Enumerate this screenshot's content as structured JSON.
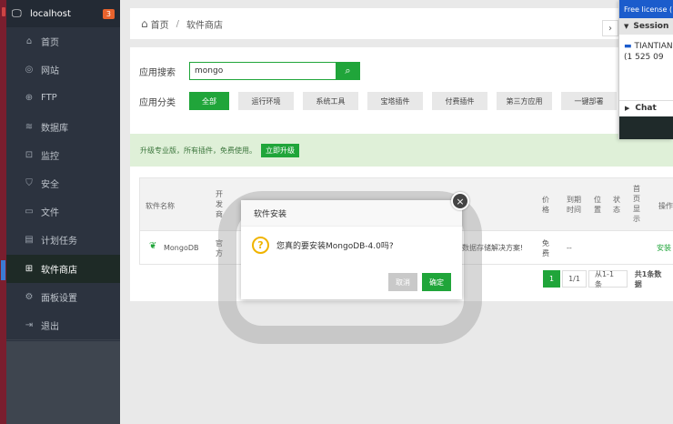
{
  "sidebar": {
    "host": "localhost",
    "badge": "3",
    "items": [
      {
        "label": "首页",
        "icon": "home-icon"
      },
      {
        "label": "网站",
        "icon": "globe-icon"
      },
      {
        "label": "FTP",
        "icon": "ftp-icon"
      },
      {
        "label": "数据库",
        "icon": "database-icon"
      },
      {
        "label": "监控",
        "icon": "monitor-icon"
      },
      {
        "label": "安全",
        "icon": "shield-icon"
      },
      {
        "label": "文件",
        "icon": "folder-icon"
      },
      {
        "label": "计划任务",
        "icon": "calendar-icon"
      },
      {
        "label": "软件商店",
        "icon": "grid-icon",
        "active": true
      },
      {
        "label": "面板设置",
        "icon": "gear-icon"
      },
      {
        "label": "退出",
        "icon": "logout-icon"
      }
    ],
    "add_label": "+"
  },
  "breadcrumb": {
    "home": "首页",
    "current": "软件商店"
  },
  "search": {
    "label": "应用搜索",
    "value": "mongo"
  },
  "categories": {
    "label": "应用分类",
    "items": [
      "全部",
      "运行环境",
      "系统工具",
      "宝塔插件",
      "付费插件",
      "第三方应用",
      "一键部署"
    ]
  },
  "promo": {
    "text": "升级专业版，所有插件，免费使用。",
    "button": "立即升级"
  },
  "table": {
    "headers": {
      "name": "软件名称",
      "dev": "开发商",
      "price": "价格",
      "expire": "到期时间",
      "pos": "位置",
      "status": "状态",
      "home_show": "首页显示",
      "ops": "操作"
    },
    "row": {
      "name": "MongoDB",
      "dev": "官方",
      "desc_tail": "能数据存储解决方案!",
      "price": "免费",
      "expire": "--",
      "action": "安装"
    }
  },
  "pager": {
    "current": "1",
    "pages": "1/1",
    "range": "从1-1条",
    "total": "共1条数据"
  },
  "dialog": {
    "title": "软件安装",
    "message": "您真的要安装MongoDB-4.0吗?",
    "cancel": "取消",
    "ok": "确定",
    "close": "×"
  },
  "remote_panel": {
    "license": "Free license (",
    "session_header": "Session",
    "session_name": "TIANTIAN",
    "session_id": "(1 525 09",
    "chat": "Chat"
  },
  "colors": {
    "accent": "#20a53a",
    "sidebar": "#2c333f",
    "license": "#1b5ccc"
  }
}
